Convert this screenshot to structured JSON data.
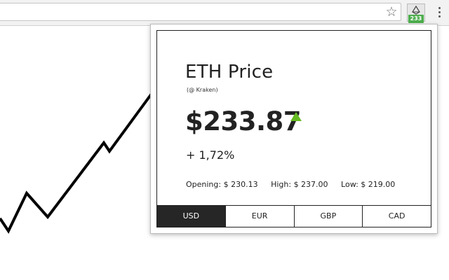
{
  "browser": {
    "star_glyph": "☆",
    "extension": {
      "icon_name": "ethereum-icon",
      "badge_text": "233",
      "badge_color": "#4cae4c"
    }
  },
  "background_chart": {
    "icon_name": "price-trend-line",
    "stroke_color": "#000000"
  },
  "popup": {
    "title": "ETH Price",
    "exchange": "(@ Kraken)",
    "price": "$233.87",
    "trend": "up",
    "trend_color": "#66bb22",
    "change": "+ 1,72%",
    "stats": {
      "opening": "Opening: $ 230.13",
      "high": "High: $ 237.00",
      "low": "Low: $ 219.00"
    },
    "currencies": [
      {
        "label": "USD",
        "active": true
      },
      {
        "label": "EUR",
        "active": false
      },
      {
        "label": "GBP",
        "active": false
      },
      {
        "label": "CAD",
        "active": false
      }
    ]
  }
}
